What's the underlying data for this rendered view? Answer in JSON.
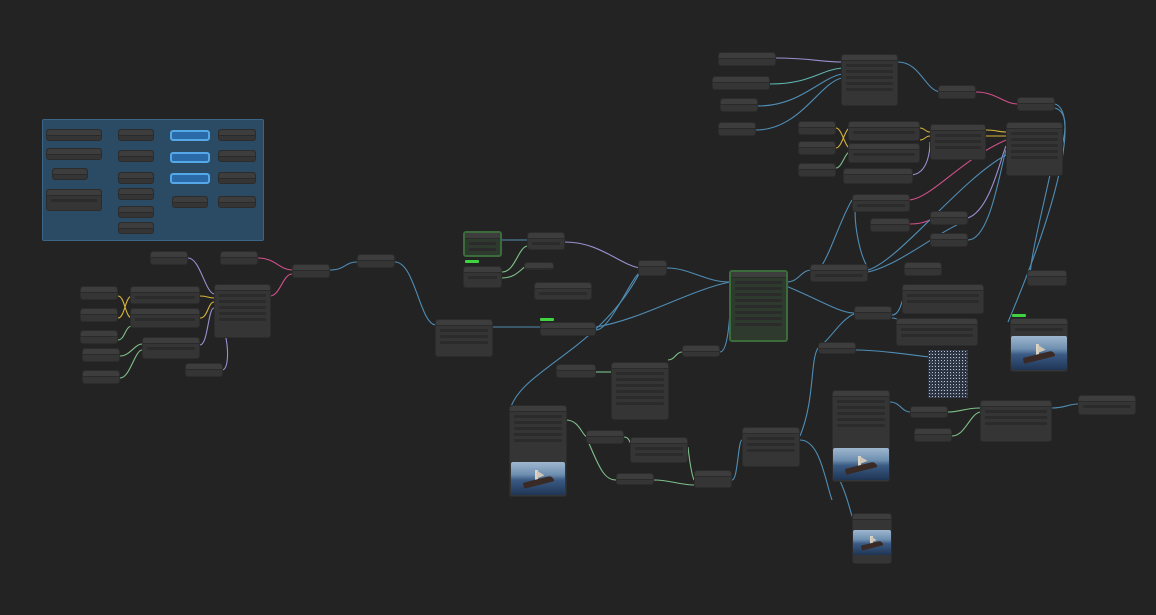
{
  "canvas": {
    "background": "#232323",
    "node_color": "#353535",
    "group_color": "#2b4a63",
    "wire_colors": {
      "blue": "#4f8db5",
      "pink": "#d0508a",
      "yellow": "#d8b43a",
      "green": "#7fc08a",
      "lavender": "#9b8fd0",
      "teal": "#5fb5b0"
    }
  },
  "group": {
    "title": ""
  },
  "tags": {
    "t1": "",
    "t2": "",
    "t3": ""
  }
}
